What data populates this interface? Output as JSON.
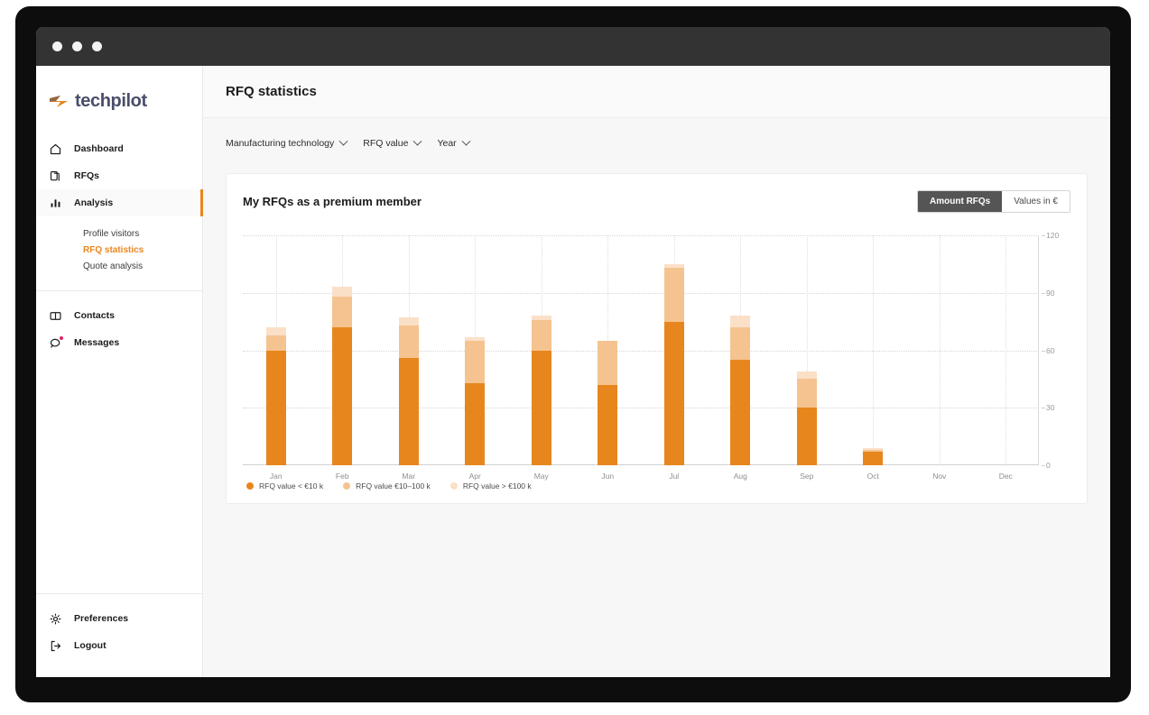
{
  "window": {
    "dots": [
      "close-dot",
      "minimize-dot",
      "maximize-dot"
    ]
  },
  "sidebar": {
    "logo_text": "techpilot",
    "items": [
      {
        "label": "Dashboard",
        "icon": "home-icon"
      },
      {
        "label": "RFQs",
        "icon": "documents-icon"
      },
      {
        "label": "Analysis",
        "icon": "bar-chart-icon"
      }
    ],
    "sub_items": [
      {
        "label": "Profile visitors"
      },
      {
        "label": "RFQ statistics"
      },
      {
        "label": "Quote analysis"
      }
    ],
    "lower_items": [
      {
        "label": "Contacts",
        "icon": "book-icon"
      },
      {
        "label": "Messages",
        "icon": "chat-bubble-icon"
      }
    ],
    "bottom_items": [
      {
        "label": "Preferences",
        "icon": "gear-icon"
      },
      {
        "label": "Logout",
        "icon": "logout-icon"
      }
    ]
  },
  "header": {
    "title": "RFQ statistics"
  },
  "filters": [
    {
      "label": "Manufacturing technology"
    },
    {
      "label": "RFQ value"
    },
    {
      "label": "Year"
    }
  ],
  "card": {
    "title": "My RFQs as a premium member",
    "toggle": {
      "active": "Amount RFQs",
      "inactive": "Values in €"
    }
  },
  "colors": {
    "accent": "#e8861e",
    "series_dark": "#e8861e",
    "series_mid": "#f5c390",
    "series_light": "#fbe0c8",
    "logo_text": "#4a4e69"
  },
  "chart_data": {
    "type": "bar",
    "title": "My RFQs as a premium member",
    "stacked": true,
    "xlabel": "",
    "ylabel": "",
    "ylim": [
      0,
      120
    ],
    "yticks": [
      0,
      30,
      60,
      90,
      120
    ],
    "grid": true,
    "legend_position": "bottom-left",
    "categories": [
      "Jan",
      "Feb",
      "Mar",
      "Apr",
      "May",
      "Jun",
      "Jul",
      "Aug",
      "Sep",
      "Oct",
      "Nov",
      "Dec"
    ],
    "series": [
      {
        "name": "RFQ value < €10 k",
        "color": "#e8861e",
        "values": [
          60,
          72,
          56,
          43,
          60,
          42,
          75,
          55,
          30,
          7,
          0,
          0
        ]
      },
      {
        "name": "RFQ value €10–100 k",
        "color": "#f5c390",
        "values": [
          8,
          16,
          17,
          22,
          16,
          23,
          28,
          17,
          15,
          1,
          0,
          0
        ]
      },
      {
        "name": "RFQ value > €100 k",
        "color": "#fbe0c8",
        "values": [
          4,
          5,
          4,
          2,
          2,
          0,
          2,
          6,
          4,
          1,
          0,
          0
        ]
      }
    ],
    "totals": [
      72,
      93,
      77,
      67,
      78,
      65,
      105,
      78,
      49,
      9,
      0,
      0
    ]
  }
}
